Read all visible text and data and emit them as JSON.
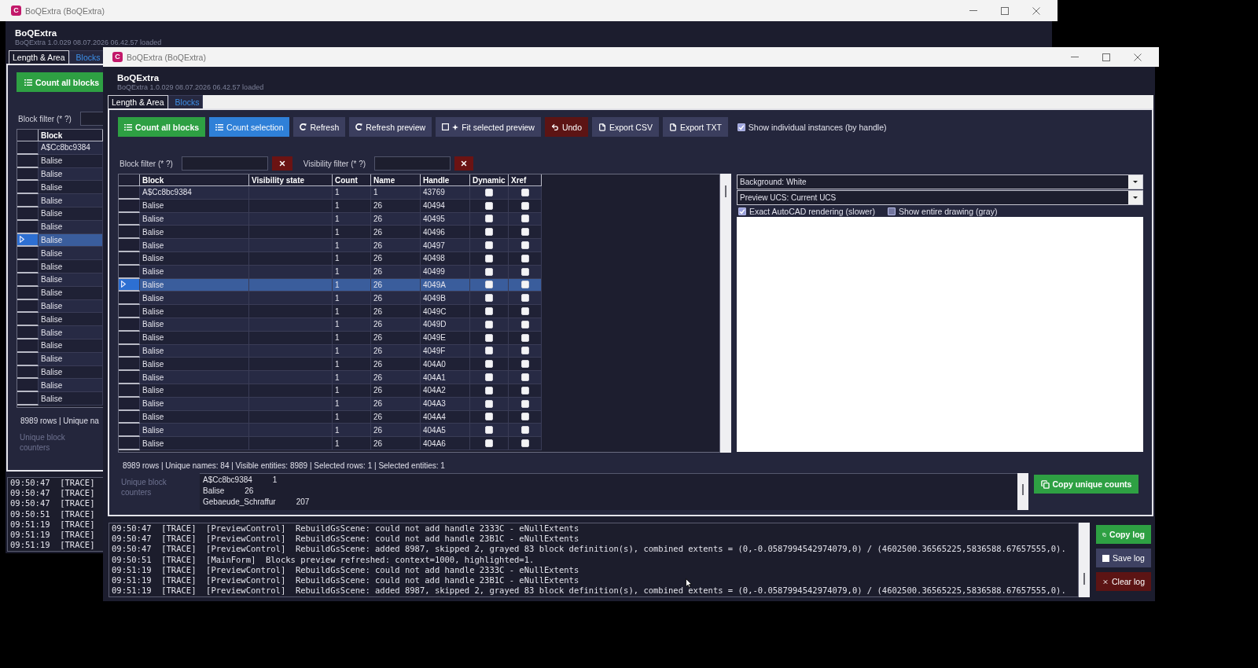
{
  "background_window": {
    "title": "BoQExtra (BoQExtra)",
    "logo_letter": "C",
    "app_name": "BoQExtra",
    "version": "BoQExtra 1.0.029 08.07.2026 06.42.57 loaded",
    "tabs": [
      {
        "label": "Length & Area",
        "selected": false
      },
      {
        "label": "Blocks",
        "selected": true
      }
    ],
    "toolbar": [
      {
        "label": "Count all blocks",
        "kind": "count_all"
      }
    ],
    "filters": [
      {
        "label": "Block filter (* ?)"
      }
    ],
    "table": {
      "columns": [
        "Block"
      ],
      "rows": [
        {
          "block": "A$Cc8bc9384",
          "selected": false
        },
        {
          "block": "Balise",
          "selected": false
        },
        {
          "block": "Balise",
          "selected": false
        },
        {
          "block": "Balise",
          "selected": false
        },
        {
          "block": "Balise",
          "selected": false
        },
        {
          "block": "Balise",
          "selected": false
        },
        {
          "block": "Balise",
          "selected": false
        },
        {
          "block": "Balise",
          "selected": true
        },
        {
          "block": "Balise",
          "selected": false
        },
        {
          "block": "Balise",
          "selected": false
        },
        {
          "block": "Balise",
          "selected": false
        },
        {
          "block": "Balise",
          "selected": false
        },
        {
          "block": "Balise",
          "selected": false
        },
        {
          "block": "Balise",
          "selected": false
        },
        {
          "block": "Balise",
          "selected": false
        },
        {
          "block": "Balise",
          "selected": false
        },
        {
          "block": "Balise",
          "selected": false
        },
        {
          "block": "Balise",
          "selected": false
        },
        {
          "block": "Balise",
          "selected": false
        },
        {
          "block": "Balise",
          "selected": false
        }
      ]
    },
    "status": "8989 rows | Unique na",
    "counters_label": "Unique block counters",
    "log": [
      "09:50:47  [TRACE]",
      "09:50:47  [TRACE]",
      "09:50:47  [TRACE]",
      "09:50:51  [TRACE]",
      "09:51:19  [TRACE]",
      "09:51:19  [TRACE]",
      "09:51:19  [TRACE]"
    ]
  },
  "main_window": {
    "title": "BoQExtra (BoQExtra)",
    "logo_letter": "C",
    "app_name": "BoQExtra",
    "version": "BoQExtra 1.0.029 08.07.2026 06.42.57 loaded",
    "tabs": [
      {
        "label": "Length & Area",
        "selected": false
      },
      {
        "label": "Blocks",
        "selected": true
      }
    ],
    "toolbar": [
      {
        "label": "Count all blocks",
        "kind": "count_all"
      },
      {
        "label": "Count selection",
        "kind": "count_selection"
      },
      {
        "label": "Refresh",
        "kind": "refresh"
      },
      {
        "label": "Refresh preview",
        "kind": "refresh_preview"
      },
      {
        "label": "Fit selected preview",
        "kind": "fit"
      },
      {
        "label": "Undo",
        "kind": "undo"
      },
      {
        "label": "Export CSV",
        "kind": "export"
      },
      {
        "label": "Export TXT",
        "kind": "export"
      }
    ],
    "show_instances": {
      "label": "Show individual instances (by handle)",
      "checked": true
    },
    "filters": [
      {
        "label": "Block filter (* ?)"
      },
      {
        "label": "Visibility filter (* ?)"
      }
    ],
    "table": {
      "columns": [
        "Block",
        "Visibility state",
        "Count",
        "Name",
        "Handle",
        "Dynamic",
        "Xref"
      ],
      "rows": [
        {
          "block": "A$Cc8bc9384",
          "count": "1",
          "name": "1",
          "handle": "43769",
          "dynamic": false,
          "xref": false,
          "selected": false
        },
        {
          "block": "Balise",
          "count": "1",
          "name": "26",
          "handle": "40494",
          "dynamic": false,
          "xref": false,
          "selected": false
        },
        {
          "block": "Balise",
          "count": "1",
          "name": "26",
          "handle": "40495",
          "dynamic": false,
          "xref": false,
          "selected": false
        },
        {
          "block": "Balise",
          "count": "1",
          "name": "26",
          "handle": "40496",
          "dynamic": false,
          "xref": false,
          "selected": false
        },
        {
          "block": "Balise",
          "count": "1",
          "name": "26",
          "handle": "40497",
          "dynamic": false,
          "xref": false,
          "selected": false
        },
        {
          "block": "Balise",
          "count": "1",
          "name": "26",
          "handle": "40498",
          "dynamic": false,
          "xref": false,
          "selected": false
        },
        {
          "block": "Balise",
          "count": "1",
          "name": "26",
          "handle": "40499",
          "dynamic": false,
          "xref": false,
          "selected": false
        },
        {
          "block": "Balise",
          "count": "1",
          "name": "26",
          "handle": "4049A",
          "dynamic": false,
          "xref": false,
          "selected": true
        },
        {
          "block": "Balise",
          "count": "1",
          "name": "26",
          "handle": "4049B",
          "dynamic": false,
          "xref": false,
          "selected": false
        },
        {
          "block": "Balise",
          "count": "1",
          "name": "26",
          "handle": "4049C",
          "dynamic": false,
          "xref": false,
          "selected": false
        },
        {
          "block": "Balise",
          "count": "1",
          "name": "26",
          "handle": "4049D",
          "dynamic": false,
          "xref": false,
          "selected": false
        },
        {
          "block": "Balise",
          "count": "1",
          "name": "26",
          "handle": "4049E",
          "dynamic": false,
          "xref": false,
          "selected": false
        },
        {
          "block": "Balise",
          "count": "1",
          "name": "26",
          "handle": "4049F",
          "dynamic": false,
          "xref": false,
          "selected": false
        },
        {
          "block": "Balise",
          "count": "1",
          "name": "26",
          "handle": "404A0",
          "dynamic": false,
          "xref": false,
          "selected": false
        },
        {
          "block": "Balise",
          "count": "1",
          "name": "26",
          "handle": "404A1",
          "dynamic": false,
          "xref": false,
          "selected": false
        },
        {
          "block": "Balise",
          "count": "1",
          "name": "26",
          "handle": "404A2",
          "dynamic": false,
          "xref": false,
          "selected": false
        },
        {
          "block": "Balise",
          "count": "1",
          "name": "26",
          "handle": "404A3",
          "dynamic": false,
          "xref": false,
          "selected": false
        },
        {
          "block": "Balise",
          "count": "1",
          "name": "26",
          "handle": "404A4",
          "dynamic": false,
          "xref": false,
          "selected": false
        },
        {
          "block": "Balise",
          "count": "1",
          "name": "26",
          "handle": "404A5",
          "dynamic": false,
          "xref": false,
          "selected": false
        },
        {
          "block": "Balise",
          "count": "1",
          "name": "26",
          "handle": "404A6",
          "dynamic": false,
          "xref": false,
          "selected": false
        }
      ]
    },
    "preview": {
      "background": "Background: White",
      "ucs": "Preview UCS: Current UCS",
      "options": [
        {
          "label": "Exact AutoCAD rendering (slower)",
          "checked": true
        },
        {
          "label": "Show entire drawing (gray)",
          "checked": false
        }
      ]
    },
    "status": "8989 rows | Unique names: 84 | Visible entities: 8989 | Selected rows: 1 | Selected entities: 1",
    "counters": {
      "label": "Unique block counters",
      "lines": [
        {
          "name": "A$Cc8bc9384",
          "count": "1"
        },
        {
          "name": "Balise",
          "count": "26"
        },
        {
          "name": "Gebaeude_Schraffur",
          "count": "207"
        }
      ],
      "button": {
        "label": "Copy unique counts",
        "kind": "copy"
      }
    },
    "log": {
      "lines": [
        "09:50:47  [TRACE]  [PreviewControl]  RebuildGsScene: could not add handle 2333C - eNullExtents",
        "09:50:47  [TRACE]  [PreviewControl]  RebuildGsScene: could not add handle 23B1C - eNullExtents",
        "09:50:47  [TRACE]  [PreviewControl]  RebuildGsScene: added 8987, skipped 2, grayed 83 block definition(s), combined extents = (0,-0.0587994542974079,0) / (4602500.36565225,5836588.67657555,0).",
        "09:50:51  [TRACE]  [MainForm]  Blocks preview refreshed: context=1000, highlighted=1.",
        "09:51:19  [TRACE]  [PreviewControl]  RebuildGsScene: could not add handle 2333C - eNullExtents",
        "09:51:19  [TRACE]  [PreviewControl]  RebuildGsScene: could not add handle 23B1C - eNullExtents",
        "09:51:19  [TRACE]  [PreviewControl]  RebuildGsScene: added 8987, skipped 2, grayed 83 block definition(s), combined extents = (0,-0.0587994542974079,0) / (4602500.36565225,5836588.67657555,0)."
      ],
      "buttons": [
        {
          "label": "Copy log",
          "kind": "copy"
        },
        {
          "label": "Save log",
          "kind": "save"
        },
        {
          "label": "Clear log",
          "kind": "clear"
        }
      ]
    }
  }
}
